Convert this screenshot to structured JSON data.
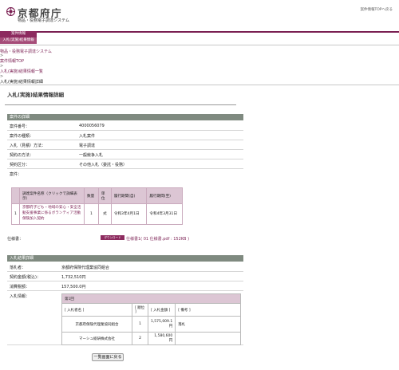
{
  "header": {
    "logo_title": "京都府庁",
    "logo_subtitle": "物品・役務電子調達システム",
    "top_link": "案件情報TOPへ戻る"
  },
  "nav": {
    "tab_primary": "案件情報",
    "tab_secondary": "入札(実施)結果情報"
  },
  "breadcrumb": [
    {
      "label": "物品・役務電子調達システム"
    },
    {
      "label": "案件情報TOP"
    },
    {
      "label": "入札(実施)結果情報一覧"
    },
    {
      "label": "入札(実施)結果情報詳細"
    }
  ],
  "breadcrumb_separator": ">",
  "page_title": "入札(実施)結果情報詳細",
  "details_section": {
    "title": "案件の詳細",
    "rows": [
      {
        "label": "案件番号：",
        "value": "4000056079"
      },
      {
        "label": "案件の種類：",
        "value": "入札案件"
      },
      {
        "label": "入札（見積）方法：",
        "value": "電子調達"
      },
      {
        "label": "契約の方法：",
        "value": "一般競争入札"
      },
      {
        "label": "契約区分：",
        "value": "その他入札（委託・役務）"
      },
      {
        "label": "案件：",
        "value": ""
      }
    ]
  },
  "items_table": {
    "headers": [
      "",
      "調達案件名称（クリックで詳細表示）",
      "数量",
      "単位",
      "履行期間(自)",
      "履行期間(至)"
    ],
    "row": {
      "no": "1",
      "name": "京都府子ども・地域の安心・安全活動支援事業に係るボランティア活動保険加入契約",
      "quantity": "1",
      "unit": "式",
      "from": "令和3年4月1日",
      "to": "令和4年3月31日"
    }
  },
  "spec": {
    "label": "仕様書：",
    "download_label": "ダウンロード",
    "link": "仕様書1( 01 仕様書.pdf : 152KB )"
  },
  "result_section": {
    "title": "入札結果詳細",
    "rows": [
      {
        "label": "落札者：",
        "value": "京都府保険代理業協同組合"
      },
      {
        "label": "契約金額(税込)：",
        "value": "1,732,510円"
      },
      {
        "label": "消費税額：",
        "value": "157,500.0円"
      },
      {
        "label": "入札情報：",
        "value": ""
      }
    ]
  },
  "bid_table": {
    "round": "第1回",
    "headers": [
      "[ 入札者名 ]",
      "[ 順位 ]",
      "[ 入札金額 ]",
      "[ 備考 ]"
    ],
    "rows": [
      {
        "name": "京都府保険代理業協同組合",
        "rank": "1",
        "amount": "1,575,009.1円",
        "note": "落札"
      },
      {
        "name": "マーシュ総研株式会社",
        "rank": "2",
        "amount": "1,580,600円",
        "note": ""
      }
    ]
  },
  "back_button": "一覧画面に戻る",
  "colors": {
    "brand": "#7a1f52",
    "section_bar": "#7f8a80",
    "table_header": "#dcc6d4"
  }
}
